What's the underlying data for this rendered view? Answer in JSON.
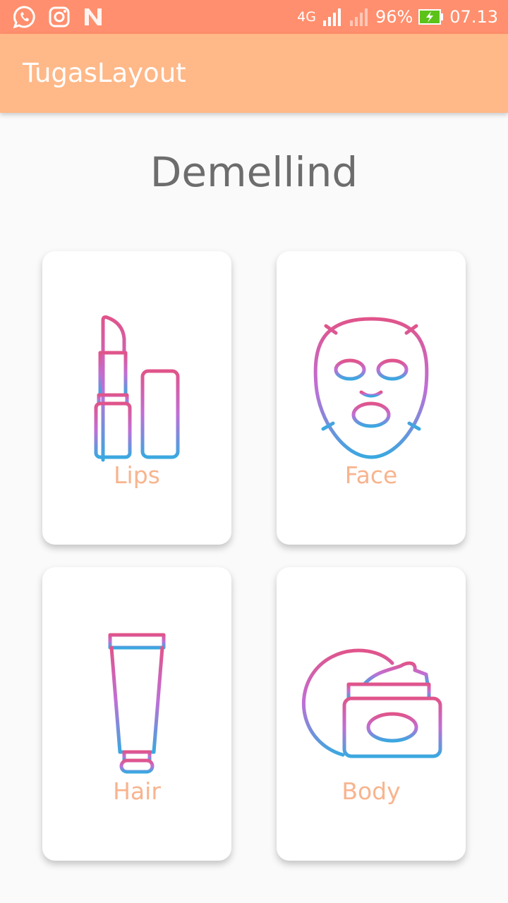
{
  "status_bar": {
    "network": "4G",
    "sim": "1",
    "battery": "96%",
    "time": "07.13",
    "left_icons": [
      "whatsapp-icon",
      "instagram-icon",
      "n-app-icon"
    ]
  },
  "app_bar": {
    "title": "TugasLayout"
  },
  "brand": {
    "title": "Demellind"
  },
  "categories": [
    {
      "label": "Lips",
      "icon": "lipstick-icon"
    },
    {
      "label": "Face",
      "icon": "face-mask-icon"
    },
    {
      "label": "Hair",
      "icon": "hair-tube-icon"
    },
    {
      "label": "Body",
      "icon": "body-cream-icon"
    }
  ],
  "colors": {
    "status_bar": "#ff8f6e",
    "app_bar": "#ffb888",
    "label": "#f8b48e",
    "icon_gradient_top": "#e0548a",
    "icon_gradient_mid": "#c06fd6",
    "icon_gradient_bottom": "#3aa8e0"
  }
}
